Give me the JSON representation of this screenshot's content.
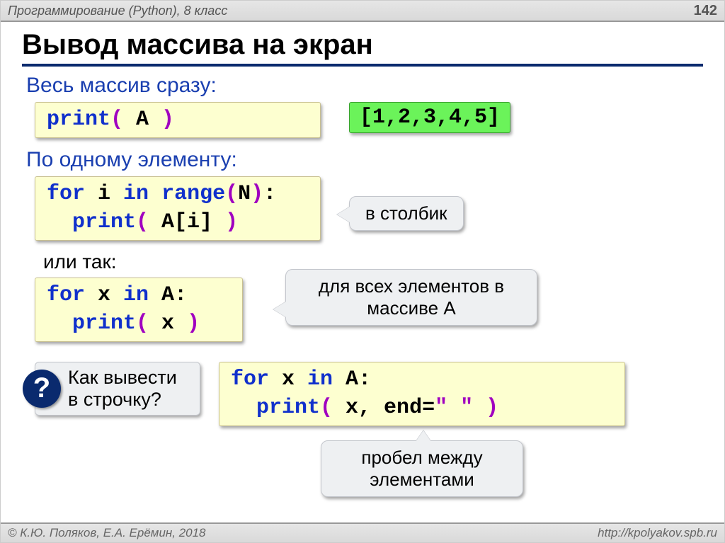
{
  "header": {
    "course": "Программирование (Python), 8 класс",
    "page": "142"
  },
  "title": "Вывод массива на экран",
  "sec1": {
    "heading": "Весь массив сразу:",
    "code": {
      "pre": "print",
      "par1": "(",
      "arg": " A ",
      "par2": ")"
    },
    "output": "[1,2,3,4,5]"
  },
  "sec2": {
    "heading": "По одному элементу:",
    "code": {
      "kw1": "for",
      "i": " i ",
      "kw2": "in",
      "sp": " ",
      "fn": "range",
      "par1": "(",
      "n": "N",
      "par2": ")",
      "colon": ":",
      "line2a": "  print",
      "par3": "(",
      "arg": " A[i] ",
      "par4": ")"
    },
    "note": "в столбик"
  },
  "sec3": {
    "or": "или так:",
    "code": {
      "kw1": "for",
      "x": " x ",
      "kw2": "in",
      "a": " A",
      "colon": ":",
      "line2a": "  print",
      "par1": "(",
      "arg": " x ",
      "par2": ")"
    },
    "note": "для всех элементов в массиве A"
  },
  "sec4": {
    "question": "Как вывести в строчку?",
    "code": {
      "kw1": "for",
      "x": " x ",
      "kw2": "in",
      "a": " A",
      "colon": ":",
      "line2a": "  print",
      "par1": "(",
      "arg": " x, end=",
      "q1": "\"",
      "sp": " ",
      "q2": "\"",
      "sp2": " ",
      "par2": ")"
    },
    "note": "пробел между элементами"
  },
  "footer": {
    "copyright": "© К.Ю. Поляков, Е.А. Ерёмин, 2018",
    "url": "http://kpolyakov.spb.ru"
  }
}
